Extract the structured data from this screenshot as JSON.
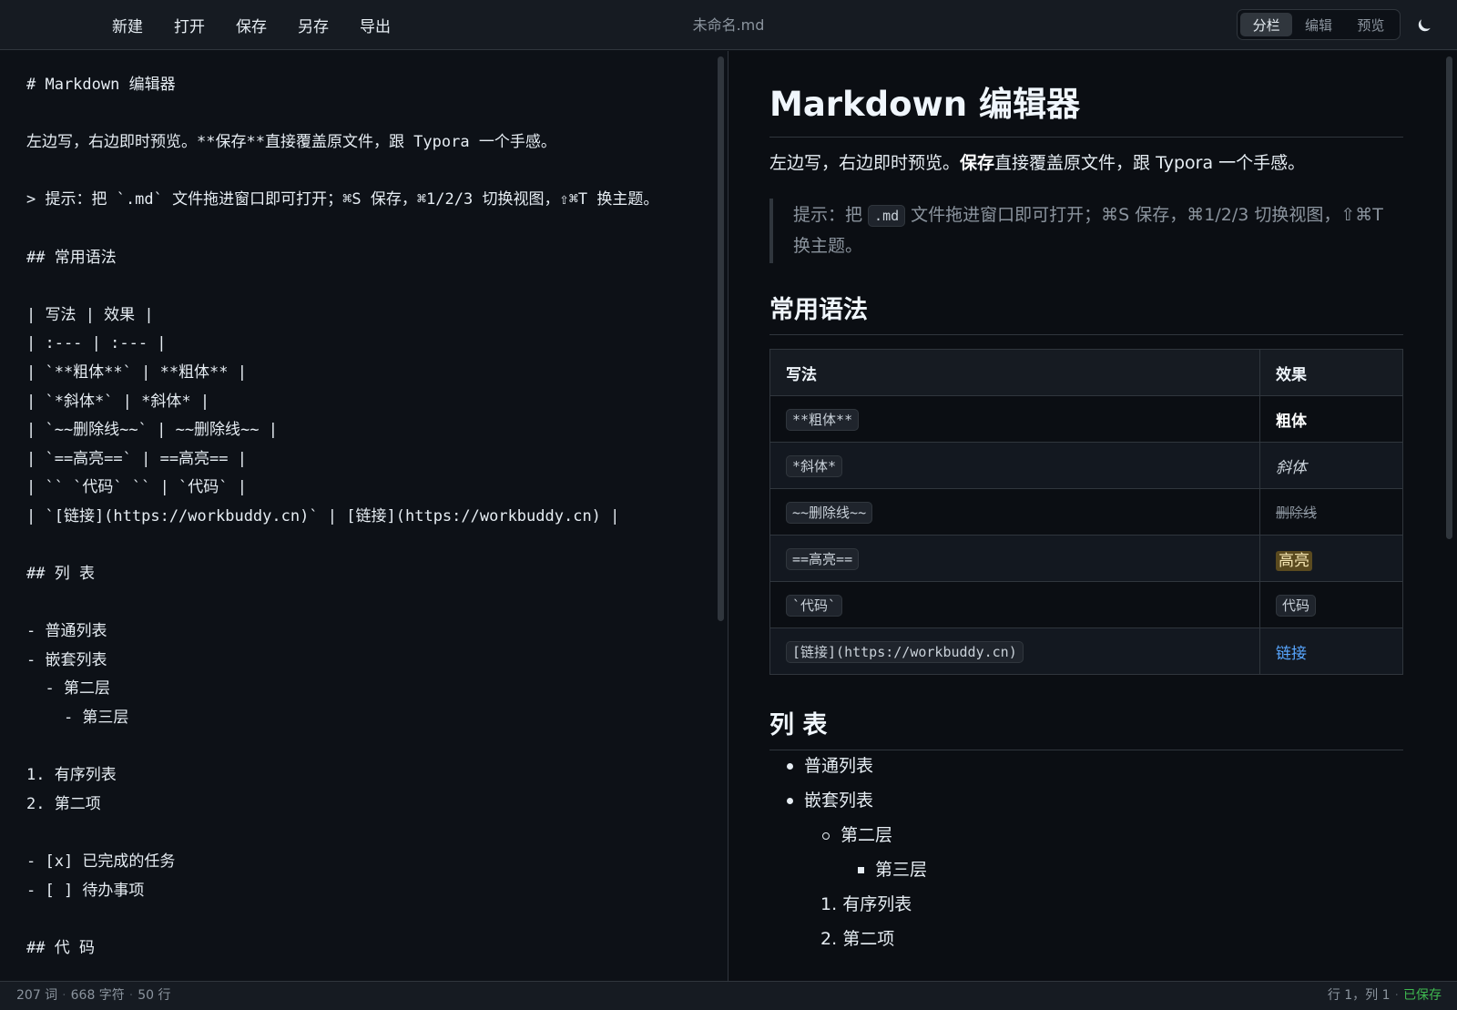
{
  "toolbar": {
    "menu": [
      "新建",
      "打开",
      "保存",
      "另存",
      "导出"
    ],
    "document_title": "未命名.md",
    "view_modes": [
      "分栏",
      "编辑",
      "预览"
    ],
    "active_view": "分栏",
    "theme_icon": "moon-icon"
  },
  "editor": {
    "lines": [
      "# Markdown 编辑器",
      "",
      "左边写，右边即时预览。**保存**直接覆盖原文件，跟 Typora 一个手感。",
      "",
      "> 提示：把 `.md` 文件拖进窗口即可打开；⌘S 保存，⌘1/2/3 切换视图，⇧⌘T 换主题。",
      "",
      "## 常用语法",
      "",
      "| 写法 | 效果 |",
      "| :--- | :--- |",
      "| `**粗体**` | **粗体** |",
      "| `*斜体*` | *斜体* |",
      "| `~~删除线~~` | ~~删除线~~ |",
      "| `==高亮==` | ==高亮== |",
      "| `` `代码` `` | `代码` |",
      "| `[链接](https://workbuddy.cn)` | [链接](https://workbuddy.cn) |",
      "",
      "## 列 表",
      "",
      "- 普通列表",
      "- 嵌套列表",
      "  - 第二层",
      "    - 第三层",
      "",
      "1. 有序列表",
      "2. 第二项",
      "",
      "- [x] 已完成的任务",
      "- [ ] 待办事项",
      "",
      "## 代 码"
    ]
  },
  "preview": {
    "h1": "Markdown 编辑器",
    "p1_before": "左边写，右边即时预览。",
    "p1_bold": "保存",
    "p1_after": "直接覆盖原文件，跟 Typora 一个手感。",
    "quote_before": "提示：把 ",
    "quote_code": ".md",
    "quote_after": " 文件拖进窗口即可打开；⌘S 保存，⌘1/2/3 切换视图，⇧⌘T 换主题。",
    "h2_syntax": "常用语法",
    "table": {
      "headers": [
        "写法",
        "效果"
      ],
      "rows": [
        {
          "syntax": "**粗体**",
          "effect": "粗体",
          "style": "bold"
        },
        {
          "syntax": "*斜体*",
          "effect": "斜体",
          "style": "italic"
        },
        {
          "syntax": "~~删除线~~",
          "effect": "删除线",
          "style": "strike"
        },
        {
          "syntax": "==高亮==",
          "effect": "高亮",
          "style": "mark"
        },
        {
          "syntax": "`代码`",
          "effect": "代码",
          "style": "code"
        },
        {
          "syntax": "[链接](https://workbuddy.cn)",
          "effect": "链接",
          "style": "link"
        }
      ]
    },
    "h2_list": "列 表",
    "list": {
      "item1": "普通列表",
      "item2": "嵌套列表",
      "item2_sub": "第二层",
      "item2_subsub": "第三层",
      "ol1": "有序列表",
      "ol2": "第二项",
      "ol1_num": "1.",
      "ol2_num": "2."
    }
  },
  "status": {
    "words": "207 词",
    "chars": "668 字符",
    "lines": "50 行",
    "cursor": "行 1，列 1",
    "saved": "已保存"
  },
  "colors": {
    "background": "#0d1117",
    "accent_link": "#58a6ff",
    "saved_green": "#3fb950"
  }
}
